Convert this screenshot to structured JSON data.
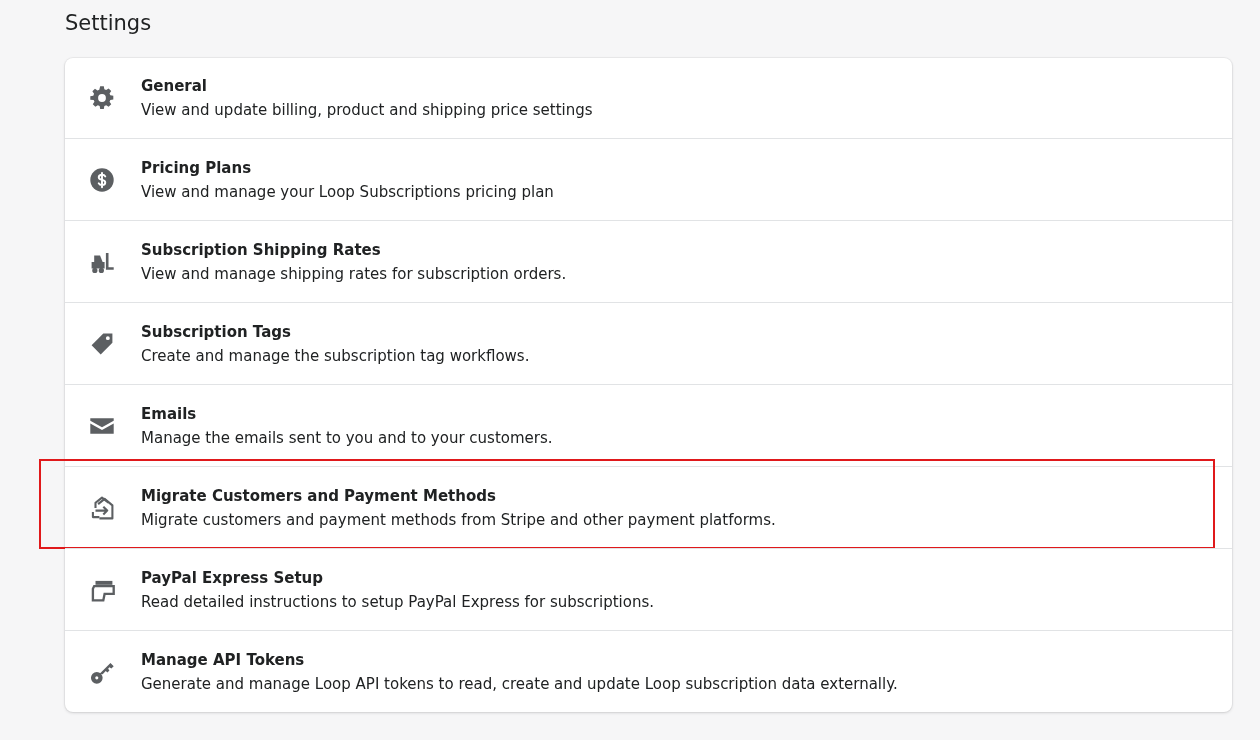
{
  "page": {
    "title": "Settings"
  },
  "items": [
    {
      "kind": "gear",
      "title": "General",
      "description": "View and update billing, product and shipping price settings",
      "highlighted": false
    },
    {
      "kind": "dollar",
      "title": "Pricing Plans",
      "description": "View and manage your Loop Subscriptions pricing plan",
      "highlighted": false
    },
    {
      "kind": "forklift",
      "title": "Subscription Shipping Rates",
      "description": "View and manage shipping rates for subscription orders.",
      "highlighted": false
    },
    {
      "kind": "tag",
      "title": "Subscription Tags",
      "description": "Create and manage the subscription tag workflows.",
      "highlighted": false
    },
    {
      "kind": "envelope",
      "title": "Emails",
      "description": "Manage the emails sent to you and to your customers.",
      "highlighted": false
    },
    {
      "kind": "migrate",
      "title": "Migrate Customers and Payment Methods",
      "description": "Migrate customers and payment methods from Stripe and other payment platforms.",
      "highlighted": true
    },
    {
      "kind": "card",
      "title": "PayPal Express Setup",
      "description": "Read detailed instructions to setup PayPal Express for subscriptions.",
      "highlighted": false
    },
    {
      "kind": "key",
      "title": "Manage API Tokens",
      "description": "Generate and manage Loop API tokens to read, create and update Loop subscription data externally.",
      "highlighted": false
    }
  ]
}
